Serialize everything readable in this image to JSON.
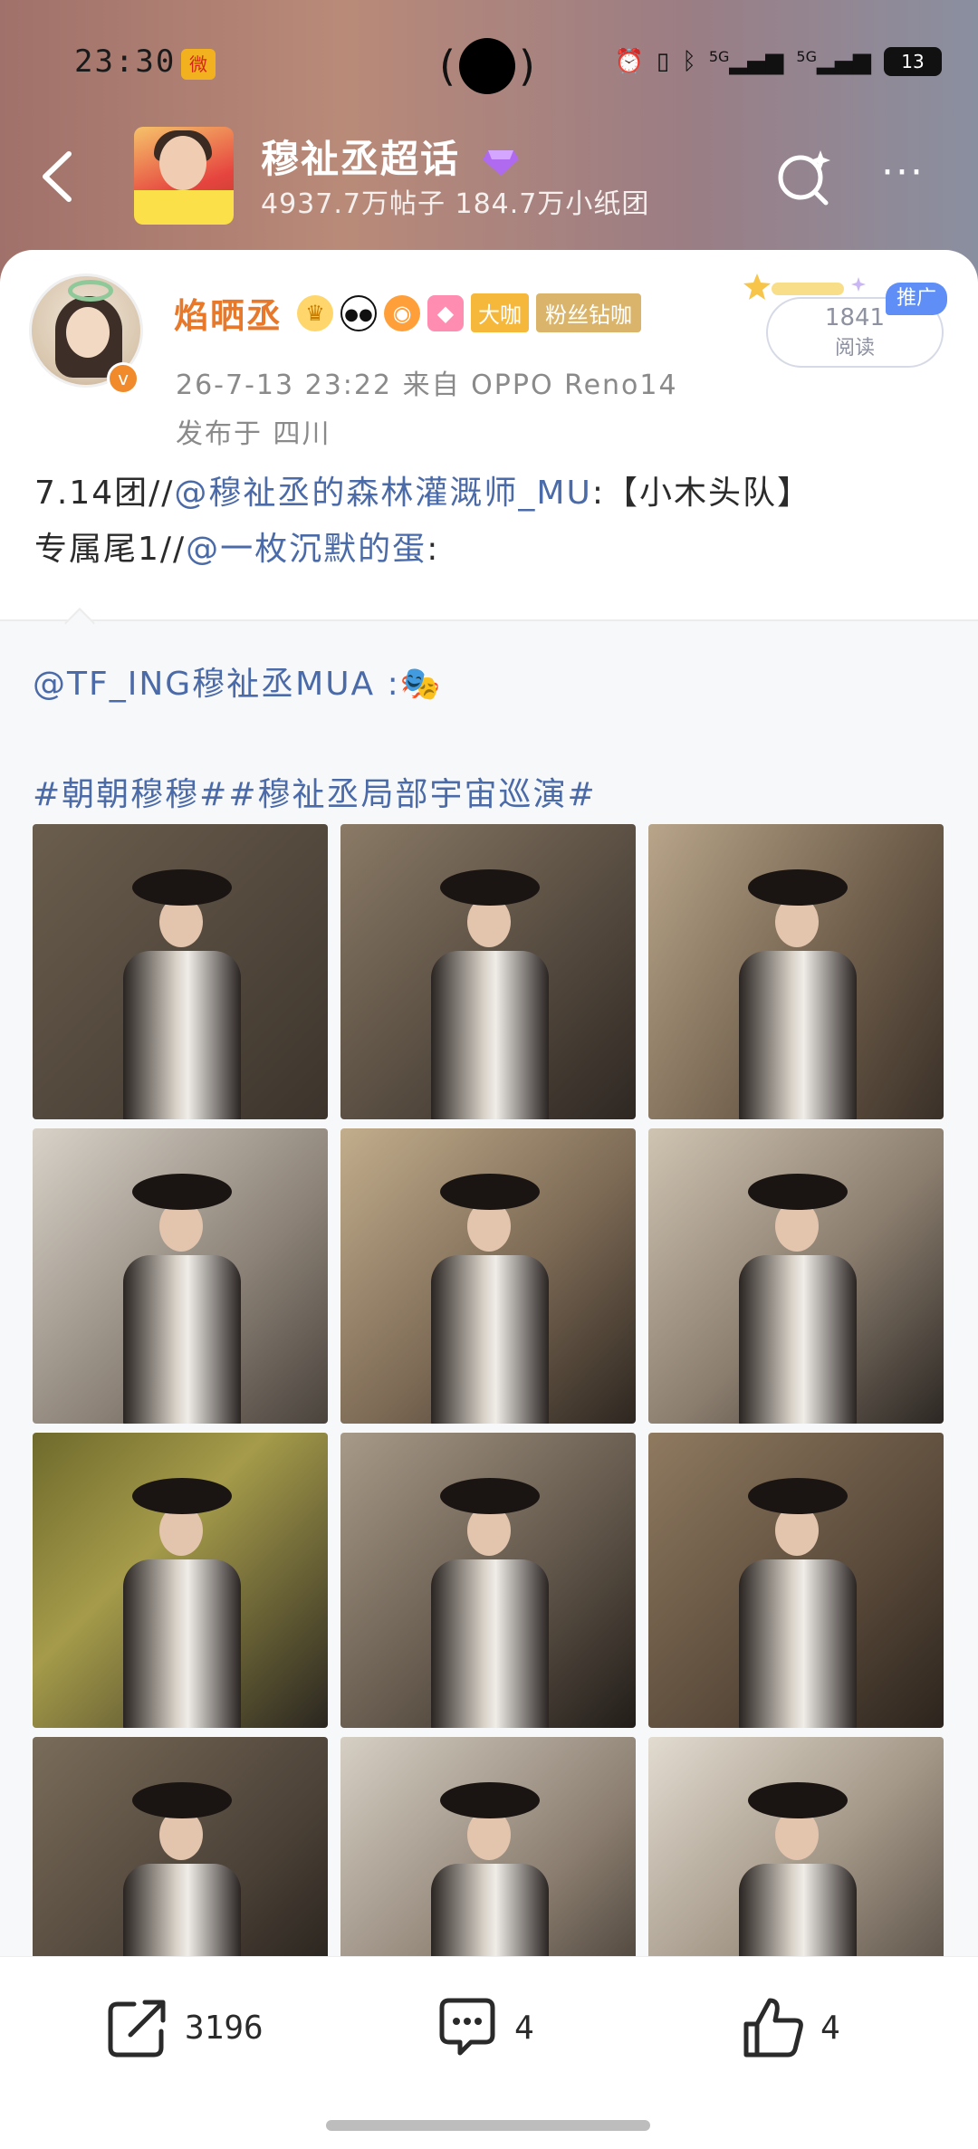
{
  "status_bar": {
    "time": "23:30",
    "network_label": "5G",
    "network_label2": "5G",
    "battery": "13"
  },
  "header": {
    "title": "穆祉丞超话",
    "subtitle": "4937.7万帖子 184.7万小纸团"
  },
  "post": {
    "username": "焰晒丞",
    "tag_dk": "大咖",
    "tag_fans": "粉丝钻咖",
    "datetime_source": "26-7-13 23:22  来自 OPPO Reno14",
    "location": "发布于 四川",
    "read_count": "1841",
    "read_label": "阅读",
    "promo_label": "推广",
    "text_line1_prefix": "7.14团//",
    "text_line1_mention": "@穆祉丞的森林灌溉师_MU",
    "text_line1_suffix": ":【小木头队】",
    "text_line2_prefix": "专属尾1//",
    "text_line2_mention": "@一枚沉默的蛋",
    "text_line2_suffix": ":"
  },
  "repost": {
    "original_user": "@TF_ING穆祉丞MUA",
    "original_suffix": " :🎭",
    "tags": "#朝朝穆穆##穆祉丞局部宇宙巡演#",
    "photo_count": 12
  },
  "actions": {
    "share_count": "3196",
    "comment_count": "4",
    "like_count": "4"
  },
  "colors": {
    "username": "#e8782a",
    "link": "#4a6aa8",
    "promo": "#5f8ef7"
  }
}
